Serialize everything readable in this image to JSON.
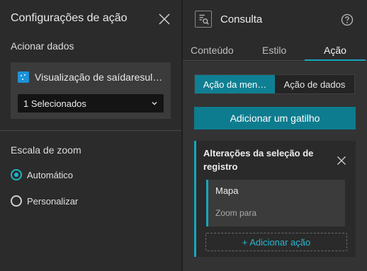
{
  "left_panel": {
    "title": "Configurações de ação",
    "trigger_section_label": "Acionar dados",
    "trigger_source": {
      "text": "Visualização de saídaresul…",
      "icon": "widget-icon",
      "icon_color": "#1c92d8"
    },
    "selection_dropdown": {
      "value": "1 Selecionados"
    },
    "zoom_section_label": "Escala de zoom",
    "zoom_options": [
      {
        "label": "Automático",
        "checked": true
      },
      {
        "label": "Personalizar",
        "checked": false
      }
    ]
  },
  "right_panel": {
    "title": "Consulta",
    "tabs": [
      {
        "label": "Conteúdo",
        "active": false
      },
      {
        "label": "Estilo",
        "active": false
      },
      {
        "label": "Ação",
        "active": true
      }
    ],
    "segmented": {
      "left_label": "Ação da men…",
      "right_label": "Ação de dados"
    },
    "add_trigger_label": "Adicionar um gatilho",
    "trigger_card": {
      "title": "Alterações da seleção de registro",
      "action": {
        "name": "Mapa",
        "description": "Zoom para"
      },
      "add_action_label": "+ Adicionar ação"
    },
    "accent_color": "#17a6bf"
  }
}
